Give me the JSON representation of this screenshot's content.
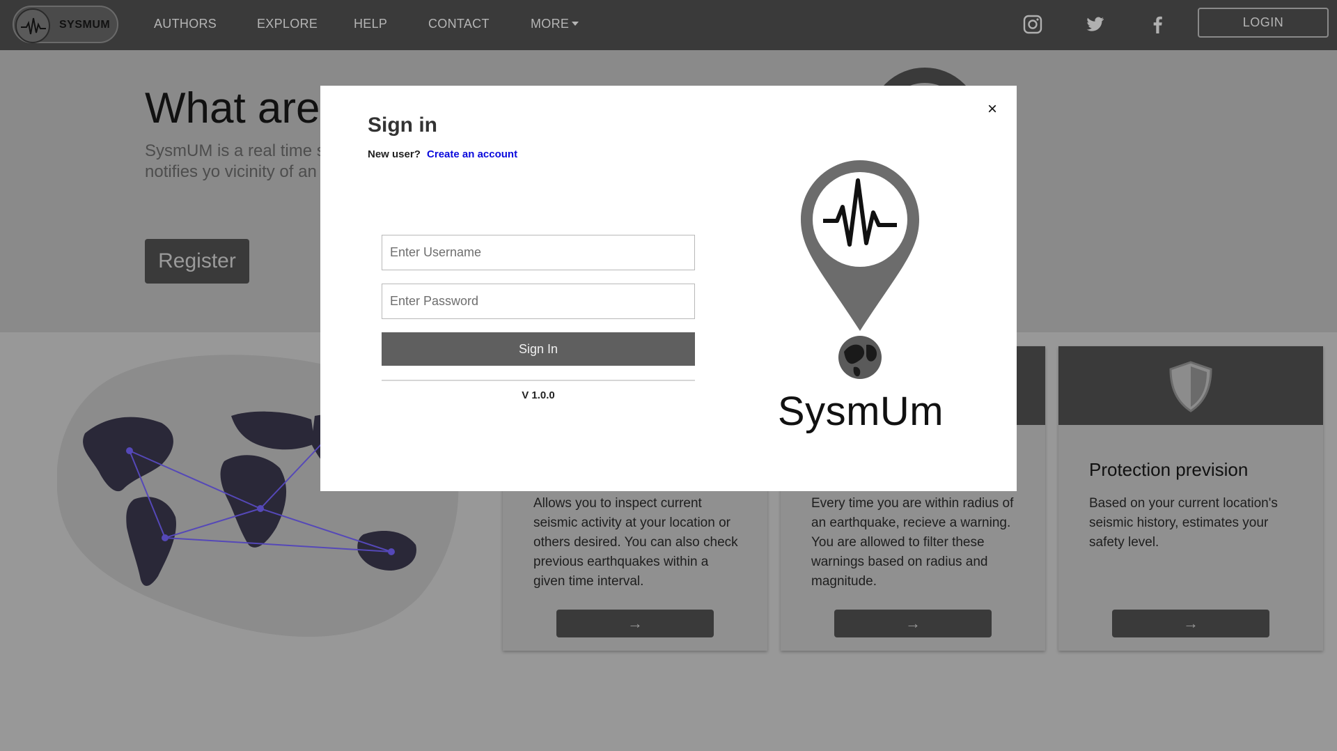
{
  "nav": {
    "brand": "SYSMUM",
    "links": [
      "AUTHORS",
      "EXPLORE",
      "HELP",
      "CONTACT"
    ],
    "more_label": "MORE",
    "social_icons": [
      "instagram-icon",
      "twitter-icon",
      "facebook-icon"
    ],
    "login_label": "LOGIN"
  },
  "hero": {
    "title": "What are",
    "description": "SysmUM is a real time system that notifies yo vicinity of an earthquak",
    "register_label": "Register"
  },
  "cards": [
    {
      "title": "",
      "description": "Allows you to inspect current seismic activity at your location or others desired. You can also check previous earthquakes within a given time interval.",
      "arrow": "→"
    },
    {
      "title": "",
      "description": "Every time you are within radius of an earthquake, recieve a warning. You are allowed to filter these warnings based on radius and magnitude.",
      "arrow": "→"
    },
    {
      "title": "Protection prevision",
      "description": "Based on your current location's seismic history, estimates your safety level.",
      "arrow": "→"
    }
  ],
  "modal": {
    "title": "Sign in",
    "new_user_text": "New user?",
    "create_account_link": "Create an account",
    "username_placeholder": "Enter Username",
    "password_placeholder": "Enter Password",
    "signin_label": "Sign In",
    "version": "V 1.0.0",
    "close_symbol": "×",
    "brand_name": "SysmUm"
  },
  "colors": {
    "navbar": "#3a3a3a",
    "overlay_gray": "#8a8a8a",
    "signin_button": "#5f5f5f",
    "link_blue": "#0a0adc"
  }
}
